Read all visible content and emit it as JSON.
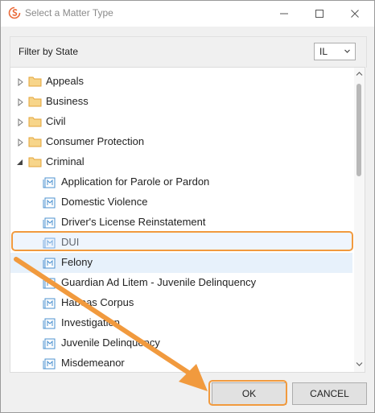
{
  "window": {
    "title": "Select a Matter Type",
    "controls": [
      "minimize-icon",
      "maximize-icon",
      "close-icon"
    ]
  },
  "filter": {
    "label": "Filter by State",
    "state_value": "IL"
  },
  "tree": {
    "categories": [
      {
        "label": "Appeals",
        "expanded": false
      },
      {
        "label": "Business",
        "expanded": false
      },
      {
        "label": "Civil",
        "expanded": false
      },
      {
        "label": "Consumer Protection",
        "expanded": false
      },
      {
        "label": "Criminal",
        "expanded": true
      }
    ],
    "criminal_children": [
      "Application for Parole or Pardon",
      "Domestic Violence",
      "Driver's License Reinstatement",
      "DUI",
      "Felony",
      "Guardian Ad Litem - Juvenile Delinquency",
      "Habeas Corpus",
      "Investigation",
      "Juvenile Delinquency",
      "Misdemeanor"
    ],
    "selected_index": 4
  },
  "buttons": {
    "ok": "OK",
    "cancel": "CANCEL"
  },
  "colors": {
    "highlight": "#f19a3e",
    "folder": "#f0b84a",
    "doc_icon": "#4b90cf",
    "selected_row": "#e7f1fb"
  }
}
